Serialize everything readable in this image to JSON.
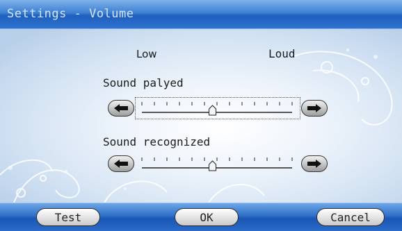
{
  "window": {
    "title": "Settings - Volume"
  },
  "scale": {
    "low": "Low",
    "loud": "Loud"
  },
  "sliders": [
    {
      "label": "Sound palyed",
      "level": 0.47
    },
    {
      "label": "Sound recognized",
      "level": 0.47
    }
  ],
  "buttons": {
    "test": "Test",
    "ok": "OK",
    "cancel": "Cancel"
  },
  "colors": {
    "title_bar": "#2f73cf",
    "background": "#d4e3f3",
    "button_face": "#e6e6e6"
  }
}
